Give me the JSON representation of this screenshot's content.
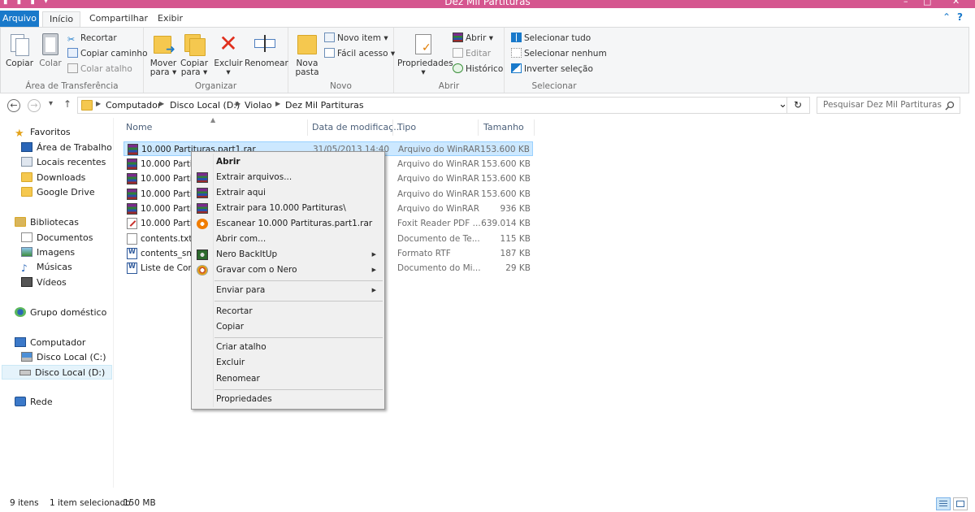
{
  "window": {
    "title": "Dez Mil Partituras",
    "minimize": "–",
    "maximize": "□",
    "close": "✕"
  },
  "tabs": {
    "file": "Arquivo",
    "items": [
      "Início",
      "Compartilhar",
      "Exibir"
    ],
    "collapse": "⌃",
    "help": "?"
  },
  "ribbon": {
    "clipboard": {
      "label": "Área de Transferência",
      "copy": "Copiar",
      "paste": "Colar",
      "cut": "Recortar",
      "copy_path": "Copiar caminho",
      "paste_shortcut": "Colar atalho"
    },
    "organize": {
      "label": "Organizar",
      "move_to_l1": "Mover",
      "move_to_l2": "para ▾",
      "copy_to_l1": "Copiar",
      "copy_to_l2": "para ▾",
      "delete_l1": "Excluir",
      "delete_l2": "▾",
      "rename": "Renomear"
    },
    "new": {
      "label": "Novo",
      "new_folder_l1": "Nova",
      "new_folder_l2": "pasta",
      "new_item": "Novo item ▾",
      "easy_access": "Fácil acesso ▾"
    },
    "open": {
      "label": "Abrir",
      "properties_l1": "Propriedades",
      "properties_l2": "▾",
      "open": "Abrir ▾",
      "edit": "Editar",
      "history": "Histórico"
    },
    "select": {
      "label": "Selecionar",
      "select_all": "Selecionar tudo",
      "select_none": "Selecionar nenhum",
      "invert": "Inverter seleção"
    }
  },
  "address": {
    "back": "←",
    "forward": "→",
    "recent": "▾",
    "up": "↑",
    "breadcrumbs": [
      "Computador",
      "Disco Local (D:)",
      "Violao",
      "Dez Mil Partituras"
    ],
    "dropdown": "⌄",
    "refresh": "↻",
    "search_placeholder": "Pesquisar Dez Mil Partituras"
  },
  "nav": {
    "favorites": "Favoritos",
    "desktop": "Área de Trabalho",
    "recent": "Locais recentes",
    "downloads": "Downloads",
    "gdrive": "Google Drive",
    "libraries": "Bibliotecas",
    "documents": "Documentos",
    "images": "Imagens",
    "music": "Músicas",
    "videos": "Vídeos",
    "homegroup": "Grupo doméstico",
    "computer": "Computador",
    "disk_c": "Disco Local (C:)",
    "disk_d": "Disco Local (D:)",
    "network": "Rede"
  },
  "columns": {
    "name": "Nome",
    "date": "Data de modificaç...",
    "type": "Tipo",
    "size": "Tamanho"
  },
  "files": [
    {
      "name": "10.000 Partituras.part1.rar",
      "date": "31/05/2013 14:40",
      "type": "Arquivo do WinRAR",
      "size": "153.600 KB",
      "icon": "rar-icon"
    },
    {
      "name": "10.000 Partituras.part2.rar",
      "date": "",
      "type": "Arquivo do WinRAR",
      "size": "153.600 KB",
      "icon": "rar-icon"
    },
    {
      "name": "10.000 Partituras.part3.rar",
      "date": "",
      "type": "Arquivo do WinRAR",
      "size": "153.600 KB",
      "icon": "rar-icon"
    },
    {
      "name": "10.000 Partituras.part4.rar",
      "date": "",
      "type": "Arquivo do WinRAR",
      "size": "153.600 KB",
      "icon": "rar-icon"
    },
    {
      "name": "10.000 Partituras.part5.rar",
      "date": "",
      "type": "Arquivo do WinRAR",
      "size": "936 KB",
      "icon": "rar-icon"
    },
    {
      "name": "10.000 Partituras.pdf",
      "date": "",
      "type": "Foxit Reader PDF ...",
      "size": "639.014 KB",
      "icon": "pdf-icon"
    },
    {
      "name": "contents.txt",
      "date": "",
      "type": "Documento de Te...",
      "size": "115 KB",
      "icon": "txt-icon"
    },
    {
      "name": "contents_small.rtf",
      "date": "",
      "type": "Formato RTF",
      "size": "187 KB",
      "icon": "rtf-icon"
    },
    {
      "name": "Liste de Compositeurs.rtf",
      "date": "",
      "type": "Documento do Mi...",
      "size": "29 KB",
      "icon": "rtf-icon"
    }
  ],
  "context_menu": {
    "open": "Abrir",
    "extract_files": "Extrair arquivos...",
    "extract_here": "Extrair aqui",
    "extract_to": "Extrair para 10.000 Partituras\\",
    "scan": "Escanear 10.000 Partituras.part1.rar",
    "open_with": "Abrir com...",
    "nero_backitup": "Nero BackItUp",
    "burn_nero": "Gravar com o Nero",
    "send_to": "Enviar para",
    "cut": "Recortar",
    "copy": "Copiar",
    "create_shortcut": "Criar atalho",
    "delete": "Excluir",
    "rename": "Renomear",
    "properties": "Propriedades",
    "submenu_arrow": "▶"
  },
  "status": {
    "items": "9 itens",
    "selected": "1 item selecionado",
    "size": "150 MB"
  },
  "colors": {
    "titlebar": "#d5568f",
    "accent": "#1979ca",
    "selection": "#cce8ff"
  }
}
